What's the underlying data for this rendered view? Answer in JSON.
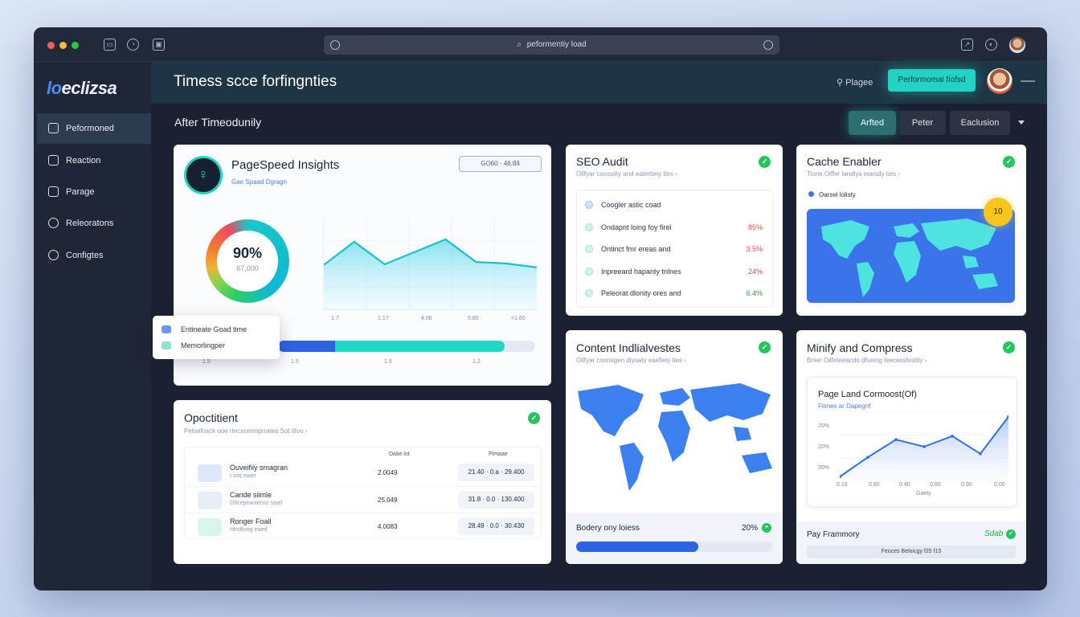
{
  "browser": {
    "url": "peformentiy load"
  },
  "sidebar": {
    "logo_main": "eclizsa",
    "logo_prefix": "lo",
    "items": [
      {
        "label": "Peformoned",
        "icon": "monitor-icon",
        "active": true
      },
      {
        "label": "Reaction",
        "icon": "home-icon",
        "active": false
      },
      {
        "label": "Parage",
        "icon": "browser-icon",
        "active": false
      },
      {
        "label": "Releoratons",
        "icon": "user-icon",
        "active": false
      },
      {
        "label": "Configtes",
        "icon": "info-icon",
        "active": false
      }
    ]
  },
  "header": {
    "title": "Timess scce forfingnties",
    "pin_label": "Plagee",
    "cta_label": "Performomal fiofsd"
  },
  "subheader": {
    "title": "After Timeodunily",
    "segments": [
      {
        "label": "Arfted",
        "active": true
      },
      {
        "label": "Peter",
        "active": false
      },
      {
        "label": "Eaclusion",
        "active": false
      }
    ]
  },
  "pagespeed": {
    "title": "PageSpeed Insights",
    "subtitle": "Gae Spaad Dgragn",
    "tag": "GO60 · 46.84",
    "score": "90%",
    "score_sub": "67,000",
    "score_percent": 90,
    "x_ticks": [
      "1.7",
      "1.17",
      "4.06",
      "5.80",
      "=1.60"
    ],
    "bar_ticks": [
      "1.5",
      "1.5",
      "1.5",
      "1.2"
    ],
    "popup": [
      {
        "label": "Entineate Goad time",
        "color": "#6f95ec"
      },
      {
        "label": "Memorlingper",
        "color": "#8fe3cf"
      }
    ]
  },
  "chart_data": {
    "type": "area",
    "title": "",
    "x": [
      "1.7",
      "1.17",
      "4.06",
      "5.80",
      "=1.60"
    ],
    "values": [
      58,
      88,
      59,
      75,
      91,
      62,
      60,
      55
    ],
    "ylim": [
      0,
      120
    ]
  },
  "seo": {
    "title": "SEO Audit",
    "subtitle": "Oilfyar coossiity and eatertieiy ties ›",
    "items": [
      {
        "label": "Coogler astic coad",
        "value": "",
        "color": "#3b73ea"
      },
      {
        "label": "Ondapnt loing foy firel",
        "value": "85%",
        "color": "#e24b4b"
      },
      {
        "label": "Ontinct fmr ereas and",
        "value": "3.5%",
        "color": "#e24b4b"
      },
      {
        "label": "Inpreeard hapanty tnlnes",
        "value": "24%",
        "color": "#e24b4b"
      },
      {
        "label": "Peleorat dlonity ores and",
        "value": "6.4%",
        "color": "#22a84a"
      }
    ]
  },
  "cache": {
    "title": "Cache Enabler",
    "subtitle": "Tione Oiffer landlys eoesdy ties ›",
    "legend": "Oarsel lolisty",
    "badge": "10"
  },
  "content": {
    "title": "Content Indlialvestes",
    "subtitle": "Oilfyar coorsigen diyoaty eaefieiy ties ›",
    "footer_label": "Bodery ony loiess",
    "footer_value": "20%",
    "progress_percent": 62
  },
  "minify": {
    "title": "Minify and Compress",
    "subtitle": "Bnier Oilfeteeacdo dfveing teecessfesbly ›",
    "chart_title": "Page Land Cormoost(Of)",
    "chart_subtitle": "Fiimes ar Dapegnf",
    "x_ticks": [
      "0.10",
      "0.80",
      "0.40",
      "0.60",
      "0.90",
      "0.00"
    ],
    "y_ticks": [
      "20%",
      "20%",
      "20%"
    ],
    "x_caption": "Gaety",
    "pay_label": "Pay Frammory",
    "pay_value": "Sdab",
    "pay_bar": "Feoces Beloicgy f25 f15"
  },
  "minify_chart": {
    "type": "line",
    "values": [
      6,
      28,
      48,
      40,
      52,
      32,
      74
    ],
    "ylim": [
      0,
      80
    ]
  },
  "optimization": {
    "title": "Opoctitient",
    "subtitle": "Petsefosck ooe rteceommprrates Sot lifoo ›",
    "col_a": "Datie lot",
    "col_b": "Pimaae",
    "rows": [
      {
        "name": "Ouveifiiy smagran",
        "desc": "Lstiq eaan",
        "value": "2.0049",
        "range": "21.40 · 0.a · 29.400",
        "icon_color": "#dce8fb"
      },
      {
        "name": "Cande siimle",
        "desc": "Oficepeantiessr stoel",
        "value": "25.049",
        "range": "31.8 · 0.0 · 130.400",
        "icon_color": "#e8eef6"
      },
      {
        "name": "Ronger Foall",
        "desc": "Heslfowg eaed",
        "value": "4.0083",
        "range": "28.49 · 0.0 · 30.430",
        "icon_color": "#d8f5ee"
      }
    ]
  }
}
